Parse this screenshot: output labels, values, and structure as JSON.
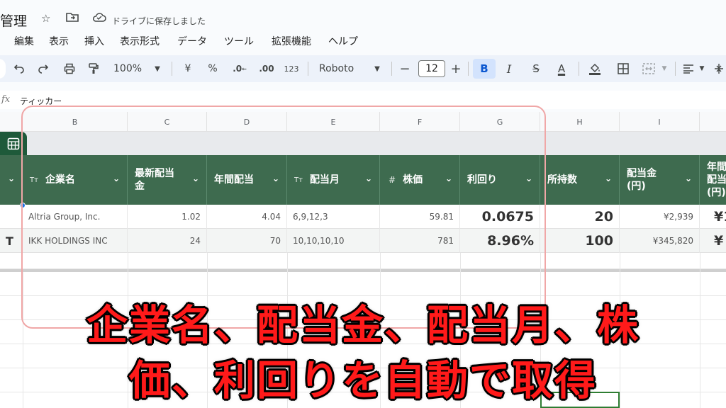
{
  "header": {
    "title": "管理",
    "save_status": "ドライブに保存しました"
  },
  "menu": [
    "編集",
    "表示",
    "挿入",
    "表示形式",
    "データ",
    "ツール",
    "拡張機能",
    "ヘルプ"
  ],
  "toolbar": {
    "zoom": "100%",
    "currency": "¥",
    "percent": "%",
    "decrease_decimal": ".0",
    "increase_decimal": ".00",
    "number_format": "123",
    "font": "Roboto",
    "font_size": "12",
    "minus": "−",
    "plus": "+",
    "bold": "B",
    "italic": "I",
    "strike": "S",
    "text_color": "A"
  },
  "formula_bar": {
    "fx": "fx",
    "content": "ティッカー"
  },
  "columns": [
    "B",
    "C",
    "D",
    "E",
    "F",
    "G",
    "H",
    "I"
  ],
  "table": {
    "headers": [
      {
        "type": "",
        "label": ""
      },
      {
        "type": "Tт",
        "label": "企業名"
      },
      {
        "type": "",
        "label": "最新配当金"
      },
      {
        "type": "",
        "label": "年間配当"
      },
      {
        "type": "Tт",
        "label": "配当月"
      },
      {
        "type": "#",
        "label": "株価"
      },
      {
        "type": "",
        "label": "利回り"
      },
      {
        "type": "",
        "label": "所持数"
      },
      {
        "type": "",
        "label": "配当金(円)"
      },
      {
        "type": "",
        "label": "年間配当(円)"
      }
    ],
    "rows": [
      {
        "prefix": "",
        "company": "Altria Group, Inc.",
        "latest_dividend": "1.02",
        "annual_dividend": "4.04",
        "dividend_months": "6,9,12,3",
        "price": "59.81",
        "yield": "0.0675",
        "shares": "20",
        "dividend_yen": "¥2,939",
        "annual_yen": "¥1"
      },
      {
        "prefix": "T",
        "company": "IKK HOLDINGS INC",
        "latest_dividend": "24",
        "annual_dividend": "70",
        "dividend_months": "10,10,10,10",
        "price": "781",
        "yield": "8.96%",
        "shares": "100",
        "dividend_yen": "¥345,820",
        "annual_yen": "¥"
      }
    ]
  },
  "overlay": {
    "line1": "企業名、配当金、配当月、株",
    "line2": "価、利回りを自動で取得"
  },
  "colors": {
    "table_header": "#3e6b4f",
    "overlay_text": "#ff1a1a",
    "accent": "#1a73e8"
  }
}
